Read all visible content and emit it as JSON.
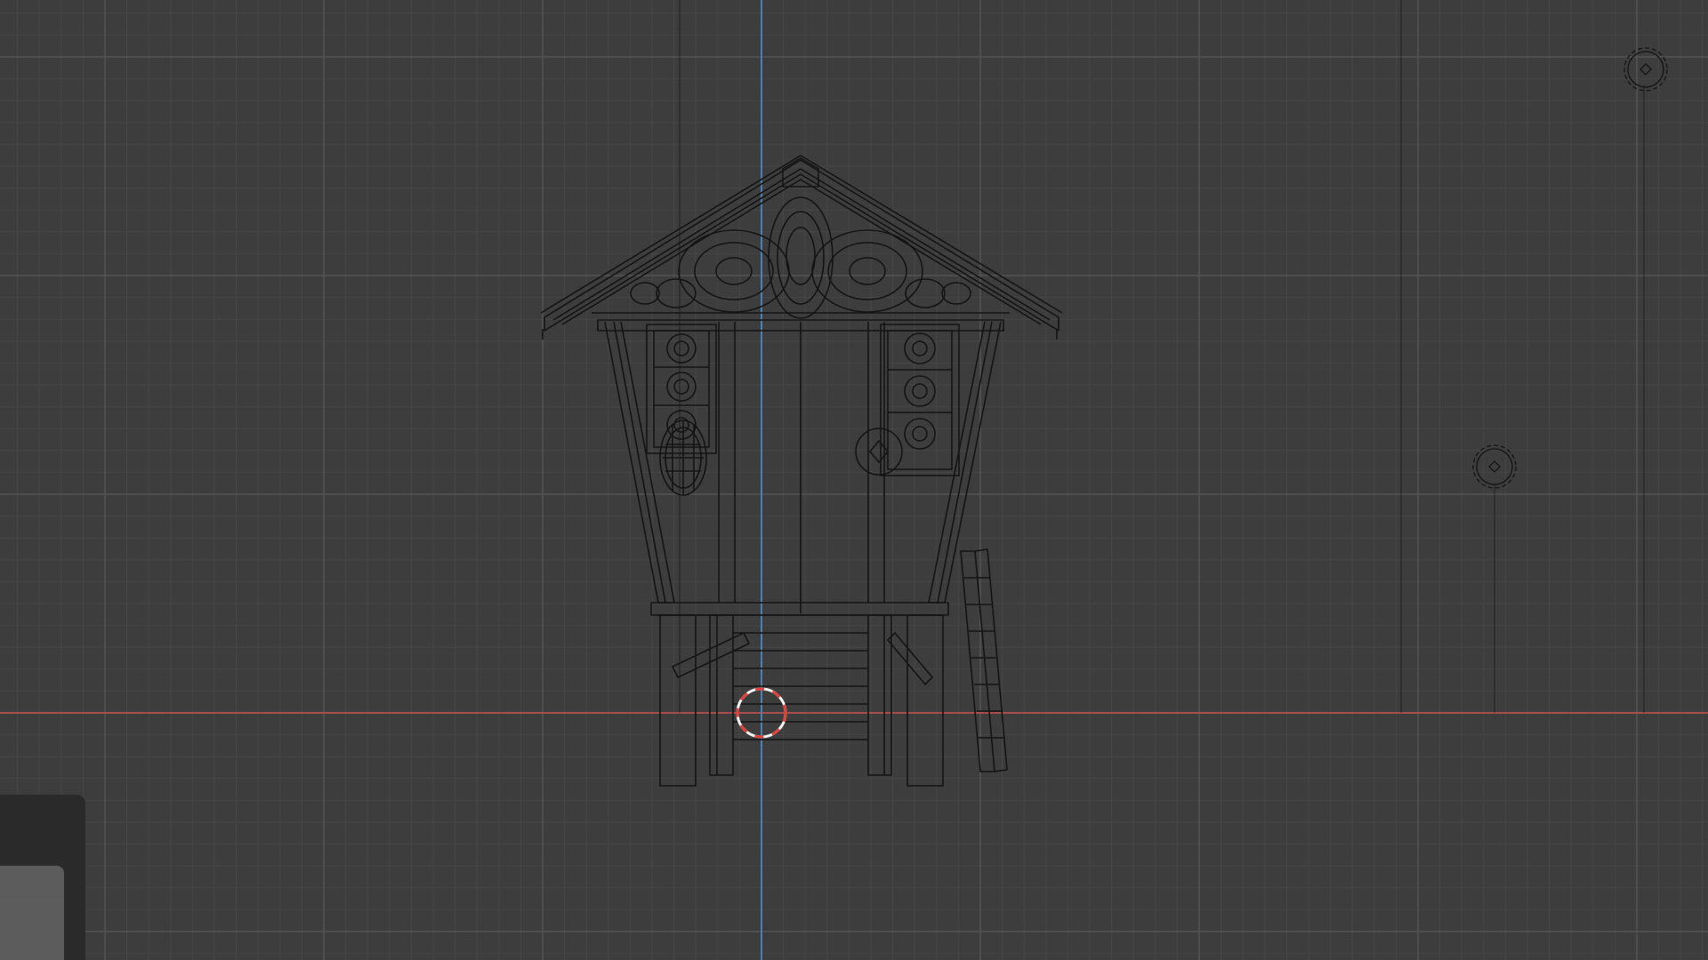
{
  "viewport": {
    "mode": "wireframe",
    "view": "front-orthographic",
    "colors": {
      "background": "#3d3d3d",
      "grid_minor": "#464646",
      "grid_major": "#555555",
      "x_axis": "#c8504e",
      "z_axis": "#4a8ed2",
      "wire": "#141414",
      "cursor_red": "#e0413c",
      "cursor_white": "#f2f2f2",
      "panel": "#2a2a2a",
      "panel_button": "#5c5c5c"
    },
    "objects": [
      {
        "name": "cabin-model",
        "icon": "mesh-icon"
      },
      {
        "name": "empty-object-1",
        "icon": "empty-icon"
      },
      {
        "name": "empty-object-2",
        "icon": "empty-icon"
      }
    ]
  }
}
